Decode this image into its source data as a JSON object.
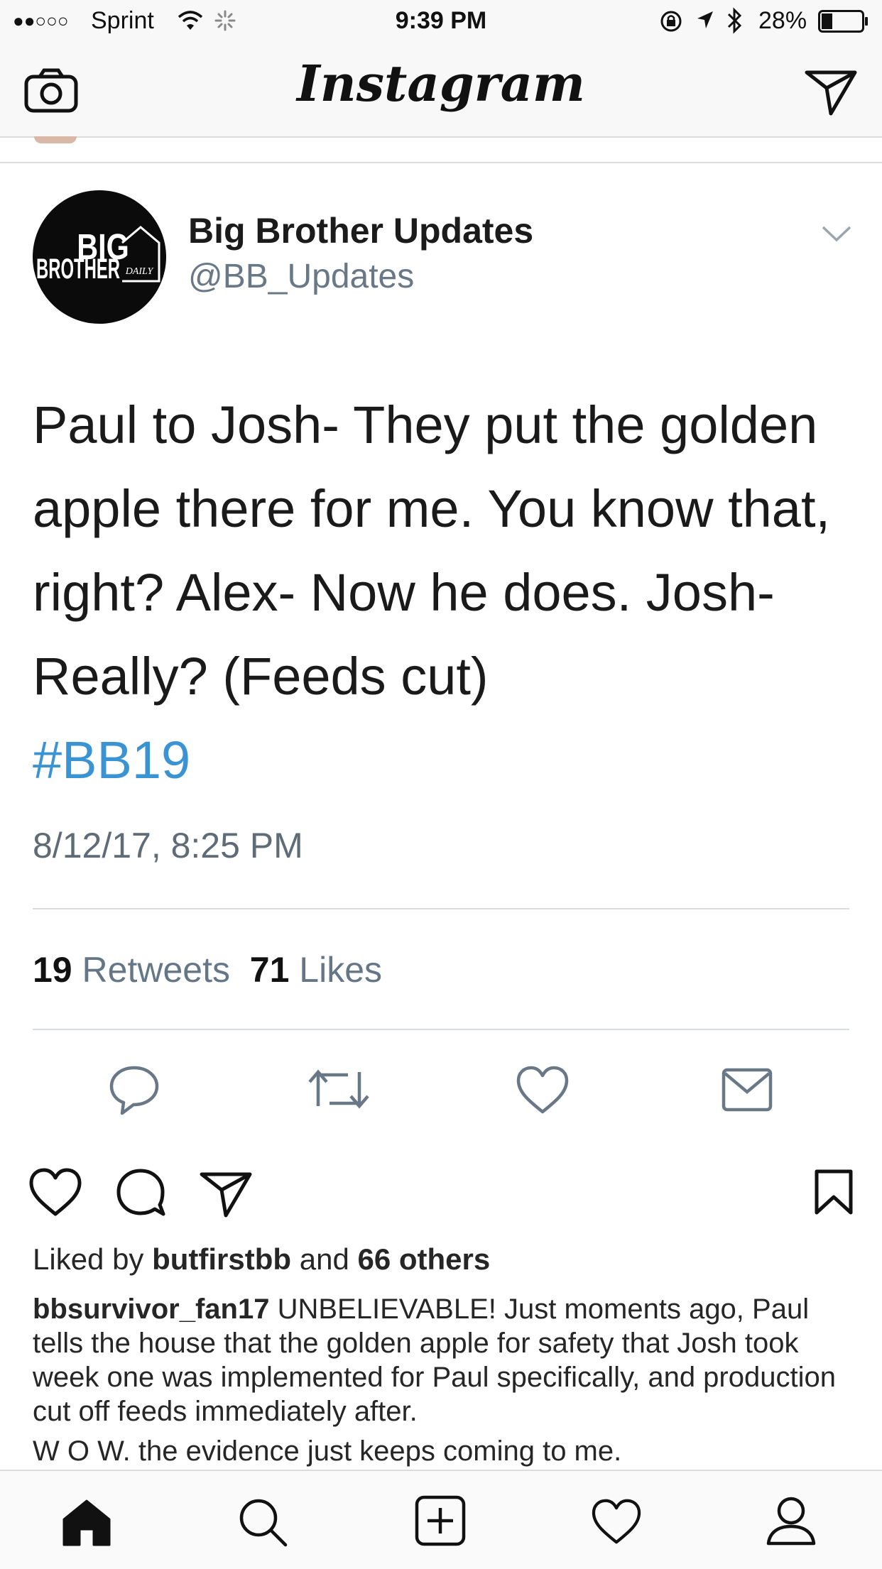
{
  "status_bar": {
    "signal": "●●○○○",
    "carrier": "Sprint",
    "time": "9:39 PM",
    "battery_percent": "28%",
    "battery_level": 0.28
  },
  "nav": {
    "app_title": "Instagram",
    "left_icon": "camera-icon",
    "right_icon": "direct-message-icon"
  },
  "tweet": {
    "avatar_text_line1": "BIG",
    "avatar_text_line2": "BROTHER",
    "avatar_text_daily": "DAILY",
    "name": "Big Brother Updates",
    "handle": "@BB_Updates",
    "text": "Paul to Josh- They put the golden apple there for me. You know that, right? Alex- Now he does. Josh- Really? (Feeds cut)",
    "hashtag": "#BB19",
    "date": "8/12/17, 8:25 PM",
    "retweets_count": "19",
    "retweets_label": "Retweets",
    "likes_count": "71",
    "likes_label": "Likes",
    "actions": [
      "reply-icon",
      "retweet-icon",
      "like-icon",
      "mail-icon"
    ]
  },
  "post": {
    "liked_prefix": "Liked by",
    "liked_user": "butfirstbb",
    "liked_and": "and",
    "liked_others": "66 others",
    "caption_user": "bbsurvivor_fan17",
    "caption_text": "UNBELIEVABLE! Just moments ago, Paul tells the house that the golden apple for safety that Josh took week one was implemented for Paul specifically, and production cut off feeds immediately after.",
    "caption_line2": "W O W. the evidence just keeps coming to me."
  },
  "tabbar": {
    "items": [
      "home-icon",
      "search-icon",
      "add-post-icon",
      "activity-icon",
      "profile-icon"
    ]
  },
  "colors": {
    "hashtag": "#3a94d4",
    "muted": "#657786"
  }
}
